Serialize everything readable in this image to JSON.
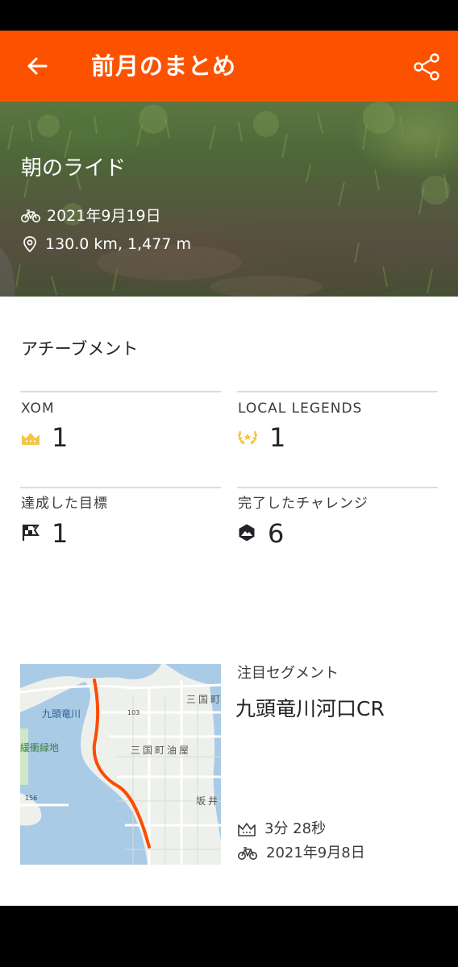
{
  "header": {
    "title": "前月のまとめ",
    "back_icon": "arrow-left-icon",
    "share_icon": "share-icon",
    "bg_color": "#fc5200"
  },
  "ride": {
    "title": "朝のライド",
    "date": "2021年9月19日",
    "stats": "130.0 km, 1,477 m"
  },
  "achievements": {
    "title": "アチーブメント",
    "items": [
      {
        "label": "XOM",
        "value": "1",
        "icon": "crown-icon"
      },
      {
        "label": "LOCAL LEGENDS",
        "value": "1",
        "icon": "laurel-icon"
      },
      {
        "label": "達成した目標",
        "value": "1",
        "icon": "goal-flag-icon"
      },
      {
        "label": "完了したチャレンジ",
        "value": "6",
        "icon": "challenge-badge-icon"
      }
    ]
  },
  "segment": {
    "label": "注目セグメント",
    "name": "九頭竜川河口CR",
    "time": "3分 28秒",
    "date": "2021年9月8日",
    "map_labels": {
      "river": "九頭竜川",
      "park": "緩衝緑地",
      "town1": "三国町油屋",
      "town2": "三国町",
      "town3": "坂井",
      "road1": "103",
      "road2": "156"
    },
    "route_color": "#fc4c02"
  }
}
